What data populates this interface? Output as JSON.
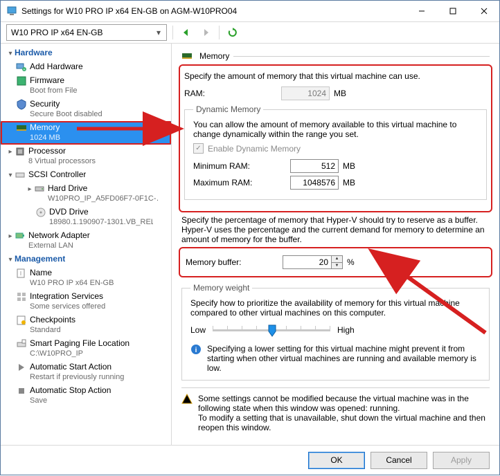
{
  "window": {
    "title": "Settings for W10 PRO IP x64 EN-GB on AGM-W10PRO04"
  },
  "toolbar": {
    "vm_name": "W10 PRO IP x64 EN-GB"
  },
  "nav": {
    "hardware_label": "Hardware",
    "add_hw": "Add Hardware",
    "firmware": "Firmware",
    "firmware_sub": "Boot from File",
    "security": "Security",
    "security_sub": "Secure Boot disabled",
    "memory": "Memory",
    "memory_sub": "1024 MB",
    "processor": "Processor",
    "processor_sub": "8 Virtual processors",
    "scsi": "SCSI Controller",
    "hard_drive": "Hard Drive",
    "hard_drive_sub": "W10PRO_IP_A5FD06F7-0F1C-…",
    "dvd": "DVD Drive",
    "dvd_sub": "18980.1.190907-1301.VB_REL…",
    "net": "Network Adapter",
    "net_sub": "External LAN",
    "management_label": "Management",
    "name": "Name",
    "name_sub": "W10 PRO IP x64 EN-GB",
    "integ": "Integration Services",
    "integ_sub": "Some services offered",
    "chk": "Checkpoints",
    "chk_sub": "Standard",
    "spf": "Smart Paging File Location",
    "spf_sub": "C:\\W10PRO_IP",
    "astart": "Automatic Start Action",
    "astart_sub": "Restart if previously running",
    "astop": "Automatic Stop Action",
    "astop_sub": "Save"
  },
  "memory_page": {
    "heading": "Memory",
    "intro": "Specify the amount of memory that this virtual machine can use.",
    "ram_label": "RAM:",
    "ram_value": "1024",
    "ram_unit": "MB",
    "dyn_legend": "Dynamic Memory",
    "dyn_desc": "You can allow the amount of memory available to this virtual machine to change dynamically within the range you set.",
    "dyn_enable": "Enable Dynamic Memory",
    "min_label": "Minimum RAM:",
    "min_value": "512",
    "min_unit": "MB",
    "max_label": "Maximum RAM:",
    "max_value": "1048576",
    "max_unit": "MB",
    "buf_desc": "Specify the percentage of memory that Hyper-V should try to reserve as a buffer. Hyper-V uses the percentage and the current demand for memory to determine an amount of memory for the buffer.",
    "buf_label": "Memory buffer:",
    "buf_value": "20",
    "buf_unit": "%",
    "weight_legend": "Memory weight",
    "weight_desc": "Specify how to prioritize the availability of memory for this virtual machine compared to other virtual machines on this computer.",
    "low": "Low",
    "high": "High",
    "info_text": "Specifying a lower setting for this virtual machine might prevent it from starting when other virtual machines are running and available memory is low.",
    "warn_text": "Some settings cannot be modified because the virtual machine was in the following state when this window was opened: running.\nTo modify a setting that is unavailable, shut down the virtual machine and then reopen this window."
  },
  "footer": {
    "ok": "OK",
    "cancel": "Cancel",
    "apply": "Apply"
  }
}
